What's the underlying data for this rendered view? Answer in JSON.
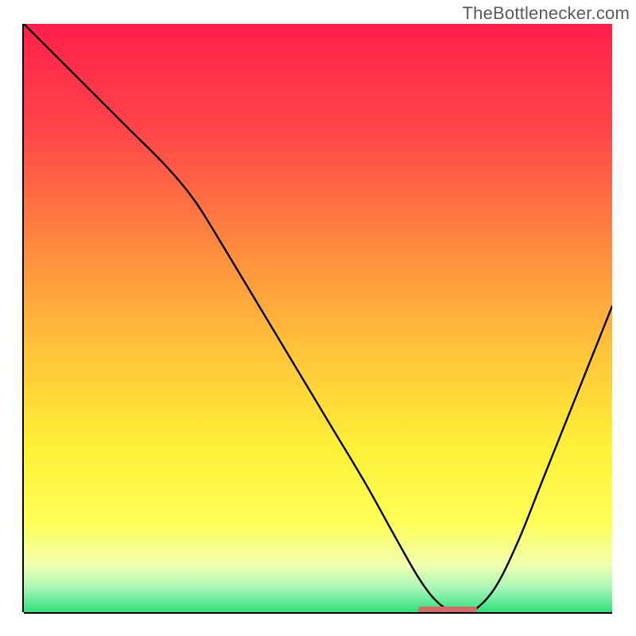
{
  "watermark": "TheBottlenecker.com",
  "chart_data": {
    "type": "line",
    "title": "",
    "xlabel": "",
    "ylabel": "",
    "xlim": [
      0,
      100
    ],
    "ylim": [
      0,
      100
    ],
    "grid": false,
    "legend": false,
    "series": [
      {
        "name": "bottleneck-curve",
        "x": [
          0,
          6,
          12,
          18,
          24,
          29,
          34,
          40,
          46,
          52,
          58,
          63,
          67,
          70,
          73,
          76,
          80,
          84,
          88,
          92,
          96,
          100
        ],
        "y": [
          100,
          94,
          88,
          82,
          76,
          70,
          62,
          52,
          42,
          32,
          22,
          13,
          6,
          2,
          0,
          0,
          4,
          12,
          22,
          32,
          42,
          52
        ]
      }
    ],
    "annotations": [
      {
        "name": "bottom-marker",
        "x_start": 67,
        "x_end": 77,
        "y": 0
      }
    ],
    "background_gradient": {
      "stops": [
        {
          "pct": 0,
          "color": "#ff1f4b"
        },
        {
          "pct": 18,
          "color": "#ff4549"
        },
        {
          "pct": 38,
          "color": "#ff8a3f"
        },
        {
          "pct": 55,
          "color": "#ffc23a"
        },
        {
          "pct": 72,
          "color": "#fff038"
        },
        {
          "pct": 85,
          "color": "#feff58"
        },
        {
          "pct": 92,
          "color": "#f0ffb0"
        },
        {
          "pct": 96,
          "color": "#a6f5b8"
        },
        {
          "pct": 100,
          "color": "#2fe07a"
        }
      ]
    }
  }
}
